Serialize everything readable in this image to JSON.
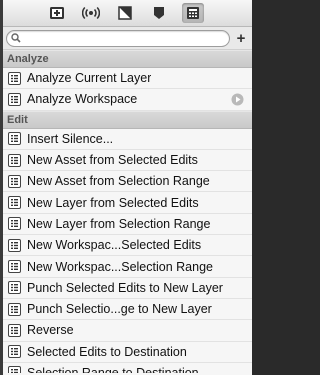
{
  "toolbar": {
    "buttons": [
      {
        "icon": "monitor-plus-icon"
      },
      {
        "icon": "broadcast-icon"
      },
      {
        "icon": "document-triangle-icon"
      },
      {
        "icon": "tag-icon"
      },
      {
        "icon": "calculator-grid-icon"
      }
    ]
  },
  "search": {
    "value": "",
    "placeholder": "",
    "add_label": "+"
  },
  "sections": {
    "analyze": {
      "title": "Analyze",
      "items": [
        "Analyze Current Layer",
        "Analyze Workspace"
      ]
    },
    "edit": {
      "title": "Edit",
      "items": [
        "Insert Silence...",
        "New Asset from Selected Edits",
        "New Asset from Selection Range",
        "New Layer from Selected Edits",
        "New Layer from Selection Range",
        "New Workspac...Selected Edits",
        "New Workspac...Selection Range",
        "Punch Selected Edits to New Layer",
        "Punch Selectio...ge to New Layer",
        "Reverse",
        "Selected Edits to Destination",
        "Selection Range to Destination"
      ]
    }
  },
  "colors": {
    "panel_bg": "#f6f6f6",
    "header_bg": "#cfcfcf",
    "text": "#111111"
  }
}
